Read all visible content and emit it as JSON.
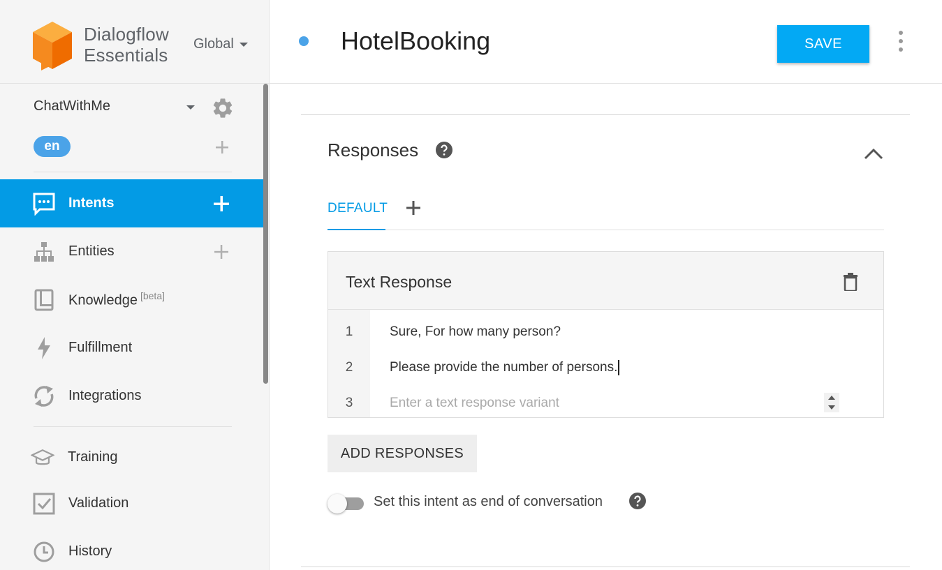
{
  "brand": {
    "name_line1": "Dialogflow",
    "name_line2": "Essentials",
    "region": "Global",
    "colors": {
      "logo_top": "#fbae40",
      "logo_left": "#f58a1f",
      "logo_right": "#ef6c00"
    }
  },
  "agent": {
    "name": "ChatWithMe",
    "language": "en"
  },
  "sidebar": {
    "items": [
      {
        "label": "Intents",
        "icon": "chat-bubble-icon",
        "active": true,
        "has_add": true
      },
      {
        "label": "Entities",
        "icon": "hierarchy-icon",
        "active": false,
        "has_add": true
      },
      {
        "label": "Knowledge",
        "badge": "[beta]",
        "icon": "book-icon",
        "active": false,
        "has_add": false
      },
      {
        "label": "Fulfillment",
        "icon": "bolt-icon",
        "active": false,
        "has_add": false
      },
      {
        "label": "Integrations",
        "icon": "sync-icon",
        "active": false,
        "has_add": false
      },
      {
        "label": "Training",
        "icon": "graduation-cap-icon",
        "active": false,
        "has_add": false
      },
      {
        "label": "Validation",
        "icon": "checkbox-icon",
        "active": false,
        "has_add": false
      },
      {
        "label": "History",
        "icon": "clock-icon",
        "active": false,
        "has_add": false
      }
    ]
  },
  "header": {
    "intent_name": "HotelBooking",
    "save_label": "SAVE"
  },
  "responses": {
    "title": "Responses",
    "tabs": [
      {
        "label": "DEFAULT",
        "active": true
      }
    ],
    "card": {
      "title": "Text Response",
      "rows": [
        {
          "no": "1",
          "text": "Sure, For how many person?"
        },
        {
          "no": "2",
          "text": "Please provide the number of persons."
        },
        {
          "no": "3",
          "text": "",
          "placeholder": "Enter a text response variant"
        }
      ]
    },
    "add_button": "ADD RESPONSES",
    "end_conversation_label": "Set this intent as end of conversation",
    "end_conversation_enabled": false
  },
  "colors": {
    "accent": "#039be5",
    "save_button": "#03a9f4",
    "language_pill": "#4ba3e8"
  }
}
